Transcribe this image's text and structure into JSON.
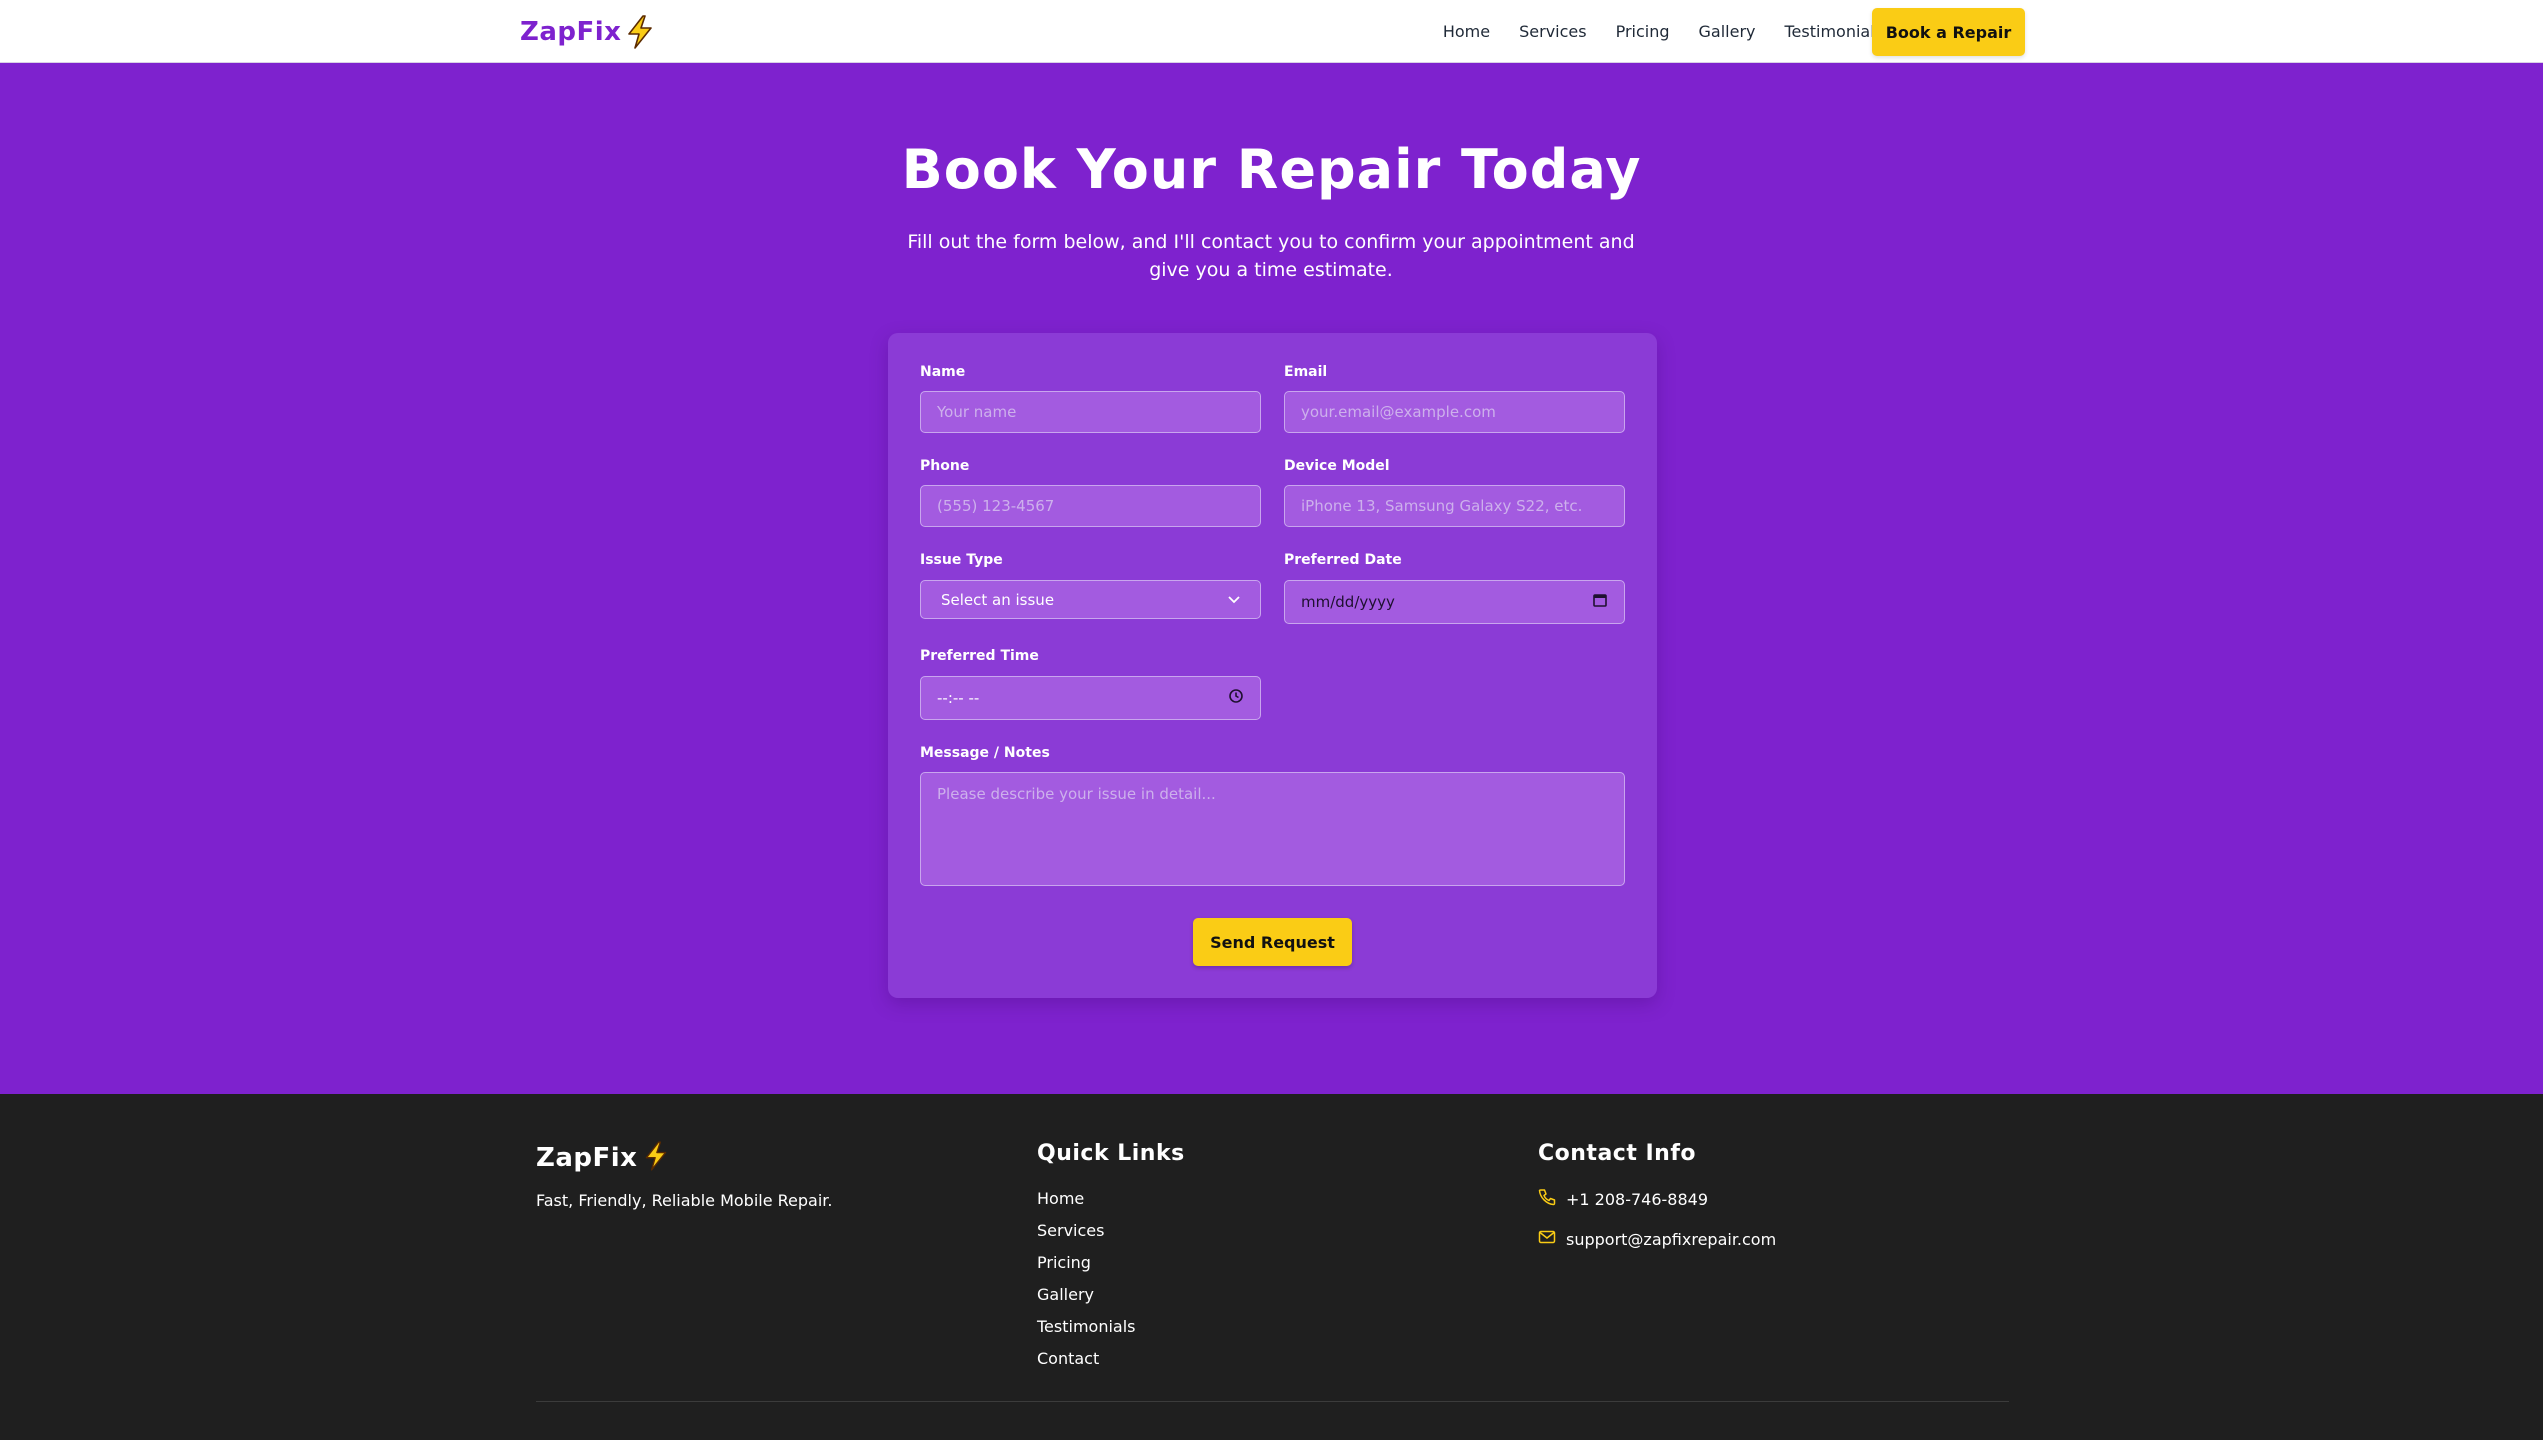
{
  "brand": {
    "name": "ZapFix",
    "icon": "lightning-bolt-icon",
    "accent": "#7e22ce",
    "highlight": "#facc15"
  },
  "nav": {
    "links": [
      "Home",
      "Services",
      "Pricing",
      "Gallery",
      "Testimonials"
    ],
    "cta_label": "Book a Repair"
  },
  "hero": {
    "title": "Book Your Repair Today",
    "subtitle": "Fill out the form below, and I'll contact you to confirm your appointment and give you a time estimate."
  },
  "form": {
    "name": {
      "label": "Name",
      "placeholder": "Your name"
    },
    "email": {
      "label": "Email",
      "placeholder": "your.email@example.com"
    },
    "phone": {
      "label": "Phone",
      "placeholder": "(555) 123-4567"
    },
    "device": {
      "label": "Device Model",
      "placeholder": "iPhone 13, Samsung Galaxy S22, etc."
    },
    "issue": {
      "label": "Issue Type",
      "value": "Select an issue"
    },
    "date": {
      "label": "Preferred Date",
      "value": "mm/dd/yyyy",
      "icon": "calendar-icon"
    },
    "time": {
      "label": "Preferred Time",
      "value": "--:-- --",
      "icon": "clock-icon"
    },
    "message": {
      "label": "Message / Notes",
      "placeholder": "Please describe your issue in detail..."
    },
    "submit_label": "Send Request"
  },
  "footer": {
    "brand": "ZapFix",
    "tagline": "Fast, Friendly, Reliable Mobile Repair.",
    "quick_links_title": "Quick Links",
    "quick_links": [
      "Home",
      "Services",
      "Pricing",
      "Gallery",
      "Testimonials",
      "Contact"
    ],
    "contact_title": "Contact Info",
    "phone": "+1 208-746-8849",
    "email": "support@zapfixrepair.com",
    "phone_icon": "phone-icon",
    "email_icon": "mail-icon"
  }
}
